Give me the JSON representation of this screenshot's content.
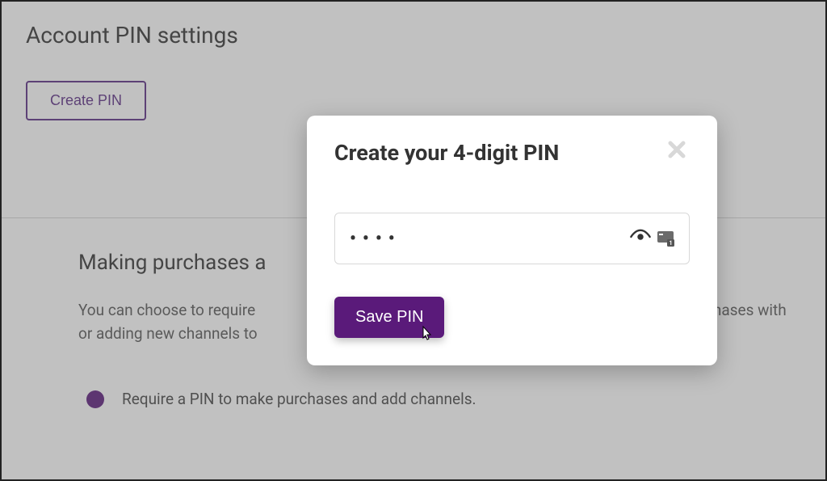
{
  "page": {
    "title": "Account PIN settings",
    "create_pin_button": "Create PIN",
    "section_heading": "Making purchases a",
    "section_text_line1": "You can choose to require",
    "section_text_line2": "or adding new channels to",
    "section_text_right": "purchases with",
    "radio_option_1": "Require a PIN to make purchases and add channels."
  },
  "modal": {
    "title": "Create your 4-digit PIN",
    "pin_value_masked": "••••",
    "save_button": "Save PIN"
  },
  "colors": {
    "brand_purple": "#5a1a7a",
    "border_purple": "#5a2d82"
  }
}
